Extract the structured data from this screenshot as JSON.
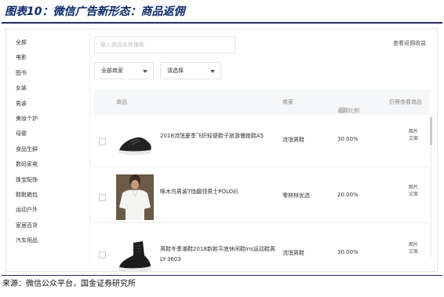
{
  "figure": {
    "title": "图表10：微信广告新形态：商品返佣",
    "source": "来源：微信公众平台，国金证券研究所"
  },
  "sidebar": {
    "items": [
      {
        "label": "全部"
      },
      {
        "label": "电影"
      },
      {
        "label": "图书"
      },
      {
        "label": "女装"
      },
      {
        "label": "男装"
      },
      {
        "label": "美妆个护"
      },
      {
        "label": "母婴"
      },
      {
        "label": "食品生鲜"
      },
      {
        "label": "数码家电"
      },
      {
        "label": "珠宝配饰"
      },
      {
        "label": "鞋靴箱包"
      },
      {
        "label": "运动户外"
      },
      {
        "label": "家居百货"
      },
      {
        "label": "汽车用品"
      }
    ]
  },
  "toolbar": {
    "search_placeholder": "输入商品名称搜索",
    "view_commission_link": "查看返佣收益",
    "shop_filter": "全部商家",
    "select_filter": "请选择"
  },
  "table": {
    "headers": {
      "product": "商品",
      "shop": "商家",
      "commission_rate": "返佣比例",
      "help_icon": "?",
      "view": "仍需查看商品"
    },
    "rows": [
      {
        "name": "2018流氓夏季飞织轻便鞋子旅游慢跑鞋A5",
        "shop": "流氓男鞋",
        "rate": "30.00%",
        "detail": "图片 文案",
        "image": "black-sneaker"
      },
      {
        "name": "啄木鸟男装T恤翻领男士POLO衫",
        "shop": "零林林优选",
        "rate": "20.00%",
        "detail": "图片 文案",
        "image": "white-polo-shirt"
      },
      {
        "name": "男鞋冬季潮鞋2018新款平底休闲鞋ins运动鞋男LY-3603",
        "shop": "流氓男鞋",
        "rate": "30.00%",
        "detail": "图片 文案",
        "image": "black-high-top-sneaker"
      }
    ]
  }
}
